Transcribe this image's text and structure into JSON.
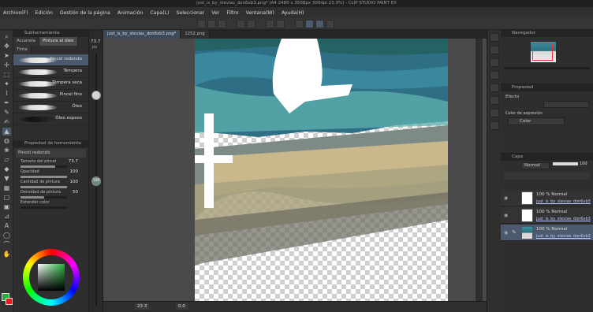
{
  "window": {
    "title": "just_is_by_stevias_don6xb3.png* (A4 2480 x 3508px 300dpi 23.3%) - CLIP STUDIO PAINT EX"
  },
  "menu": [
    "Archivo(F)",
    "Edición",
    "Gestión de la página",
    "Animación",
    "Capa(L)",
    "Seleccionar",
    "Ver",
    "Filtro",
    "Ventana(W)",
    "Ayuda(H)"
  ],
  "subtool": {
    "panel_title": "Subherramienta",
    "tabs": [
      "Acuarela",
      "Pintura al óleo"
    ],
    "group": "Tinta",
    "brushes": [
      "Pincel redondo",
      "Témpera",
      "Témpera seca",
      "Pincel fino",
      "Óleo",
      "Óleo espeso"
    ]
  },
  "tool_property": {
    "panel_title": "Propiedad de herramienta",
    "brush_name": "Pincel redondo",
    "rows": [
      {
        "label": "Tamaño del pincel",
        "value": "73.7",
        "fill": 0.74
      },
      {
        "label": "Opacidad",
        "value": "100",
        "fill": 1.0
      },
      {
        "label": "Cantidad de pintura",
        "value": "100",
        "fill": 1.0
      },
      {
        "label": "Densidad de pintura",
        "value": "50",
        "fill": 0.5
      },
      {
        "label": "Extender color",
        "value": "",
        "fill": 0.0
      }
    ]
  },
  "size_slider": {
    "value": "73.7",
    "unit": "px",
    "level": 0.3,
    "second_value": "100"
  },
  "document_tabs": [
    {
      "label": "just_is_by_stevias_don6xb3.png*",
      "active": true
    },
    {
      "label": "1252.png",
      "active": false
    }
  ],
  "status": {
    "zoom": "23.3",
    "angle": "0.0"
  },
  "navigator": {
    "panel_title": "Navegador"
  },
  "property": {
    "panel_title": "Propiedad",
    "effect_label": "Efecto",
    "color_label": "Color de expresión",
    "color_value": "Color"
  },
  "layers": {
    "panel_title": "Capa",
    "blend_mode": "Normal",
    "opacity": "100",
    "items": [
      {
        "line1": "100 % Normal",
        "line2": "just_is_by_stevias_don6xb3",
        "selected": false
      },
      {
        "line1": "100 % Normal",
        "line2": "just_is_by_stevias_don6xb3",
        "selected": false
      },
      {
        "line1": "100 % Normal",
        "line2": "just_is_by_stevias_don6xb3",
        "selected": true
      }
    ]
  },
  "colors": {
    "accent": "#4c5a6d",
    "main_color": "#1fb13a"
  }
}
